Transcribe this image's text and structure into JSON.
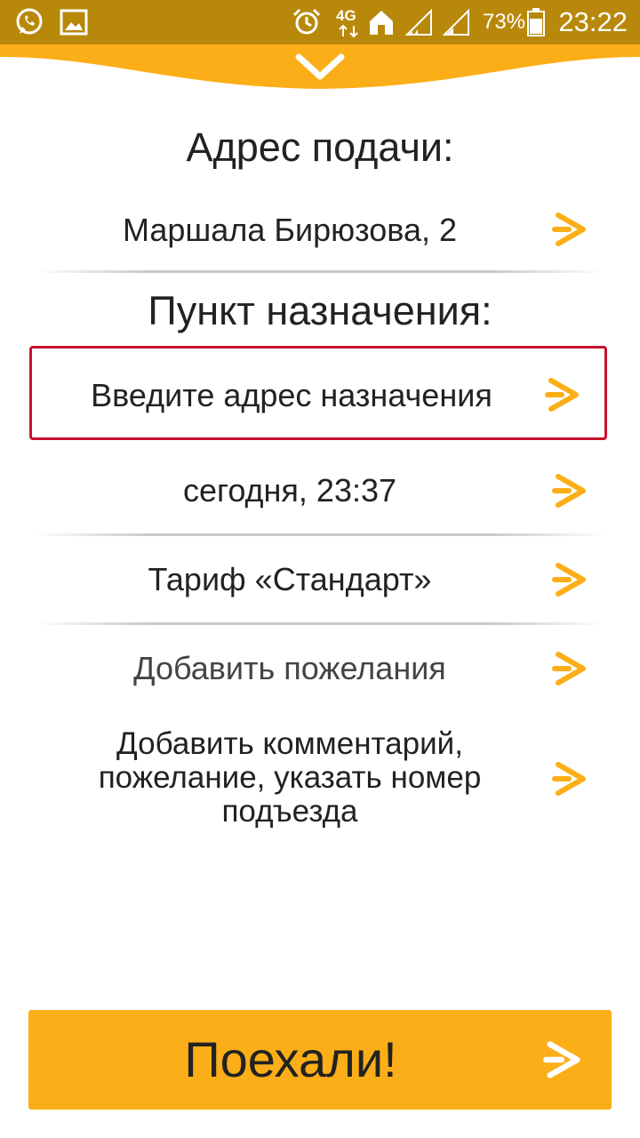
{
  "colors": {
    "accent": "#fbae17",
    "status_bar": "#b8880a",
    "highlight_border": "#c8102e"
  },
  "status_bar": {
    "icons": [
      "whatsapp-icon",
      "gallery-icon",
      "alarm-icon",
      "network-4g-icon",
      "home-icon",
      "signal-icon",
      "signal-icon-2",
      "battery-icon"
    ],
    "network": "4G",
    "battery": "73%",
    "time": "23:22"
  },
  "header": {
    "collapse_icon": "chevron-down-icon"
  },
  "pickup": {
    "heading": "Адрес подачи:",
    "address": "Маршала Бирюзова, 2"
  },
  "destination": {
    "heading": "Пункт назначения:",
    "placeholder": "Введите адрес назначения"
  },
  "options": {
    "time": "сегодня, 23:37",
    "tariff": "Тариф «Стандарт»",
    "wishes": "Добавить пожелания",
    "comment": "Добавить комментарий, пожелание, указать номер подъезда"
  },
  "submit": {
    "label": "Поехали!"
  }
}
